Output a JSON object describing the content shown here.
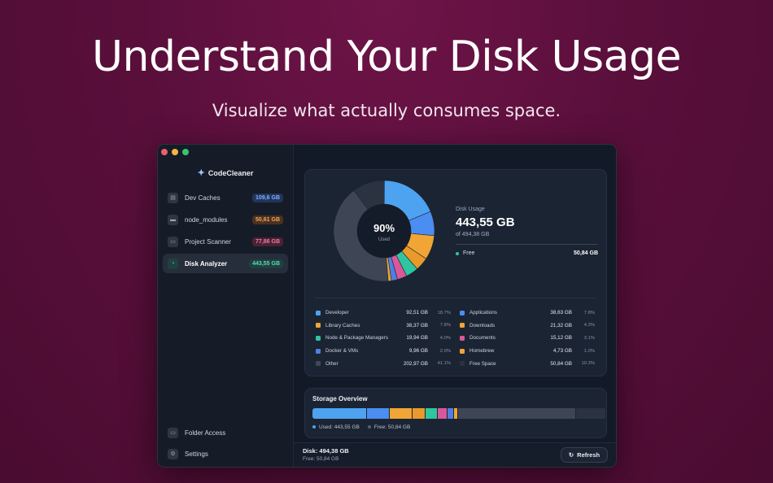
{
  "hero": {
    "title": "Understand Your Disk Usage",
    "subtitle": "Visualize what actually consumes space."
  },
  "window": {
    "traffic_colors": [
      "#ec5f6b",
      "#f4b442",
      "#38c56c"
    ]
  },
  "sidebar": {
    "app_name": "CodeCleaner",
    "items": [
      {
        "label": "Dev Caches",
        "badge": "109,6 GB",
        "badge_color": "#7fb0ff",
        "badge_bg": "#22345a",
        "icon": "drive-icon"
      },
      {
        "label": "node_modules",
        "badge": "50,61 GB",
        "badge_color": "#f2a35e",
        "badge_bg": "#4a3120",
        "icon": "folder-icon"
      },
      {
        "label": "Project Scanner",
        "badge": "77,86 GB",
        "badge_color": "#ee7aa3",
        "badge_bg": "#4a2234",
        "icon": "scan-folder-icon"
      },
      {
        "label": "Disk Analyzer",
        "badge": "443,55 GB",
        "badge_color": "#5ed6b8",
        "badge_bg": "#1f4140",
        "icon": "pie-chart-icon",
        "active": true
      }
    ],
    "bottom_items": [
      {
        "label": "Folder Access",
        "icon": "folder-lock-icon"
      },
      {
        "label": "Settings",
        "icon": "gear-icon"
      }
    ]
  },
  "disk_usage": {
    "percent_label": "90%",
    "percent_caption": "Used",
    "label": "Disk Usage",
    "value": "443,55 GB",
    "of_total": "of 494,38 GB",
    "free_label": "Free",
    "free_value": "50,84 GB",
    "used_fraction": 0.9
  },
  "legend": {
    "left": [
      {
        "name": "Developer",
        "size": "92,51 GB",
        "pct": "18.7%",
        "color": "#4da3f0"
      },
      {
        "name": "Library Caches",
        "size": "38,37 GB",
        "pct": "7.8%",
        "color": "#f0a534"
      },
      {
        "name": "Node & Package Managers",
        "size": "19,94 GB",
        "pct": "4.0%",
        "color": "#2fc5a0"
      },
      {
        "name": "Docker & VMs",
        "size": "9,96 GB",
        "pct": "2.0%",
        "color": "#4f7fe0"
      },
      {
        "name": "Other",
        "size": "202,97 GB",
        "pct": "41.1%",
        "color": "#404857"
      }
    ],
    "right": [
      {
        "name": "Applications",
        "size": "38,63 GB",
        "pct": "7.8%",
        "color": "#4b8df0"
      },
      {
        "name": "Downloads",
        "size": "21,32 GB",
        "pct": "4.3%",
        "color": "#f0a534"
      },
      {
        "name": "Documents",
        "size": "15,12 GB",
        "pct": "3.1%",
        "color": "#d8589a"
      },
      {
        "name": "Homebrew",
        "size": "4,73 GB",
        "pct": "1.0%",
        "color": "#f0a534"
      },
      {
        "name": "Free Space",
        "size": "50,84 GB",
        "pct": "10.3%",
        "color": "#2a3140"
      }
    ]
  },
  "donut_segments": [
    {
      "name": "Developer",
      "pct": 18.7,
      "color": "#4da3f0"
    },
    {
      "name": "Applications",
      "pct": 7.8,
      "color": "#4b8df0"
    },
    {
      "name": "Library Caches",
      "pct": 7.8,
      "color": "#f0a534"
    },
    {
      "name": "Downloads",
      "pct": 4.3,
      "color": "#e99a2a"
    },
    {
      "name": "Node & Package Managers",
      "pct": 4.0,
      "color": "#2fc5a0"
    },
    {
      "name": "Documents",
      "pct": 3.1,
      "color": "#d8589a"
    },
    {
      "name": "Docker & VMs",
      "pct": 2.0,
      "color": "#4f7fe0"
    },
    {
      "name": "Homebrew",
      "pct": 1.0,
      "color": "#f0a534"
    },
    {
      "name": "Other",
      "pct": 41.1,
      "color": "#3e4656"
    },
    {
      "name": "Free Space",
      "pct": 10.3,
      "color": "#2b3341"
    }
  ],
  "storage": {
    "title": "Storage Overview",
    "used_label": "Used: 443,55 GB",
    "free_label": "Free: 50,84 GB",
    "used_color": "#4da3f0",
    "free_color": "#556074"
  },
  "footer": {
    "disk": "Disk: 494,38 GB",
    "free": "Free: 50,84 GB",
    "refresh_label": "Refresh"
  }
}
